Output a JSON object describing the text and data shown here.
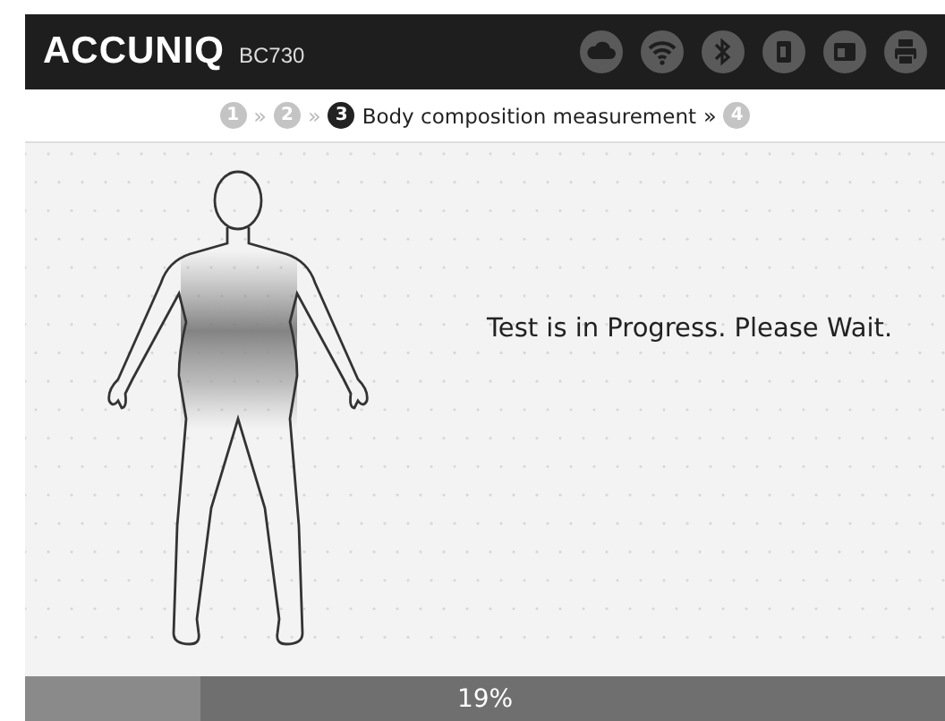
{
  "header": {
    "brand": "ACCUNIQ",
    "model": "BC730",
    "status_icons": [
      {
        "kind": "cloud"
      },
      {
        "kind": "wifi"
      },
      {
        "kind": "bluetooth"
      },
      {
        "kind": "card"
      },
      {
        "kind": "id"
      },
      {
        "kind": "printer"
      }
    ]
  },
  "steps": [
    {
      "number": "1",
      "separator": "»",
      "selected": false
    },
    {
      "number": "2",
      "separator": "»",
      "selected": false
    },
    {
      "number": "3",
      "label": "Body composition measurement",
      "separator": "»",
      "selected": true
    },
    {
      "number": "4",
      "selected": false
    }
  ],
  "message": "Test is in Progress. Please Wait.",
  "progress": {
    "level": 0.19,
    "reading": "19%"
  }
}
